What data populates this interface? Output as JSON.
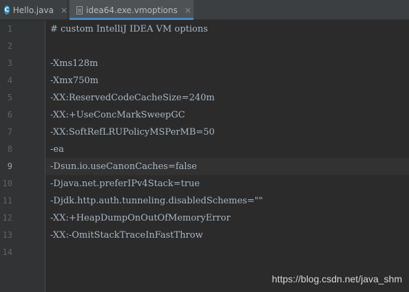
{
  "tabs": [
    {
      "label": "Hello.java",
      "icon": "java-class-icon",
      "close": "×"
    },
    {
      "label": "idea64.exe.vmoptions",
      "icon": "file-text-icon",
      "close": "×",
      "active": true
    }
  ],
  "editor": {
    "current_line": 9,
    "lines": [
      {
        "no": "1",
        "text": "# custom IntelliJ IDEA VM options"
      },
      {
        "no": "2",
        "text": ""
      },
      {
        "no": "3",
        "text": "-Xms128m"
      },
      {
        "no": "4",
        "text": "-Xmx750m"
      },
      {
        "no": "5",
        "text": "-XX:ReservedCodeCacheSize=240m"
      },
      {
        "no": "6",
        "text": "-XX:+UseConcMarkSweepGC"
      },
      {
        "no": "7",
        "text": "-XX:SoftRefLRUPolicyMSPerMB=50"
      },
      {
        "no": "8",
        "text": "-ea"
      },
      {
        "no": "9",
        "text": "-Dsun.io.useCanonCaches=false"
      },
      {
        "no": "10",
        "text": "-Djava.net.preferIPv4Stack=true"
      },
      {
        "no": "11",
        "text": "-Djdk.http.auth.tunneling.disabledSchemes=\"\""
      },
      {
        "no": "12",
        "text": "-XX:+HeapDumpOnOutOfMemoryError"
      },
      {
        "no": "13",
        "text": "-XX:-OmitStackTraceInFastThrow"
      },
      {
        "no": "14",
        "text": ""
      }
    ]
  },
  "watermark": "https://blog.csdn.net/java_shm",
  "colors": {
    "background": "#2b2b2b",
    "gutter": "#313335",
    "text": "#a9b7c6",
    "tab_accent": "#4a88c7"
  }
}
